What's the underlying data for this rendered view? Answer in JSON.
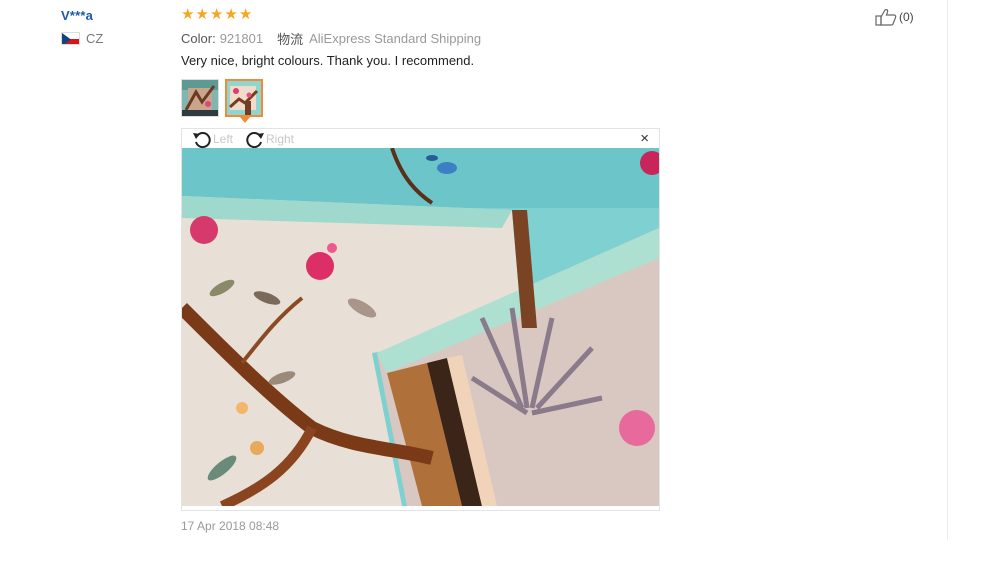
{
  "review": {
    "user_name": "V***a",
    "country_code": "CZ",
    "rating": 5,
    "stars": [
      "★",
      "★",
      "★",
      "★",
      "★"
    ],
    "color_label": "Color:",
    "color_value": "921801",
    "shipping_label": "物流",
    "shipping_value": "AliExpress Standard Shipping",
    "text": "Very nice, bright colours. Thank you. I recommend.",
    "date": "17 Apr 2018 08:48",
    "helpful_count": "(0)"
  },
  "viewer": {
    "rotate_left_label": "Left",
    "rotate_right_label": "Right",
    "close_label": "×"
  },
  "colors": {
    "star": "#f5a623",
    "username": "#1a5aa8",
    "active_thumb_border": "#f08b3a"
  }
}
